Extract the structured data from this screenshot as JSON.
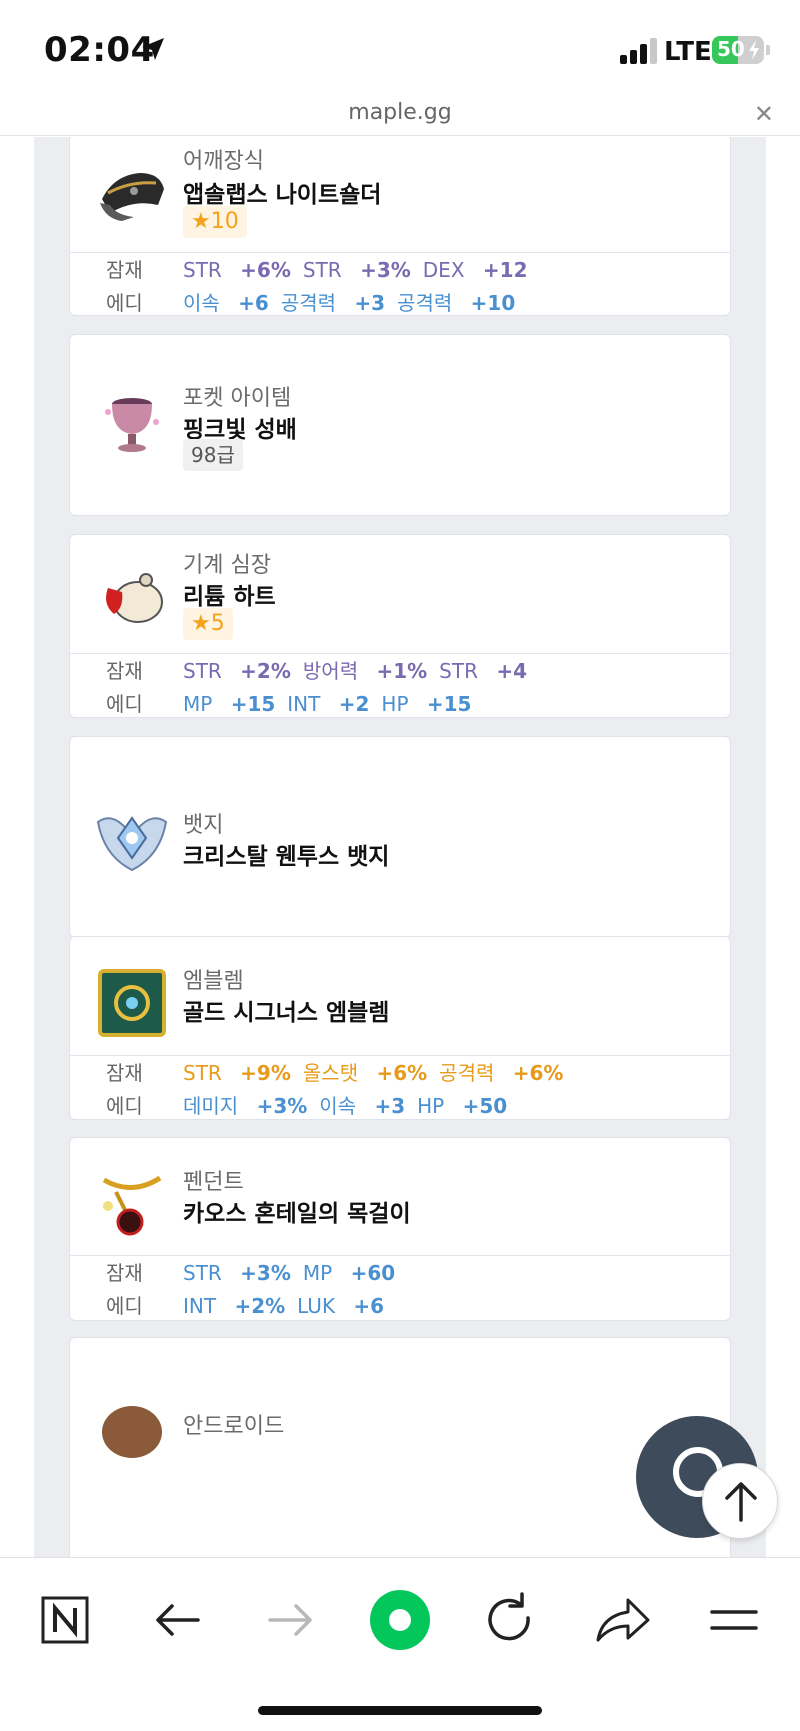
{
  "status_bar": {
    "time": "02:04",
    "network": "LTE",
    "battery": "50",
    "battery_level": 0.5
  },
  "browser": {
    "url": "maple.gg"
  },
  "labels": {
    "potential": "잠재",
    "additional": "에디"
  },
  "items": [
    {
      "category": "어깨장식",
      "name": "앱솔랩스 나이트숄더",
      "badge": "★10",
      "potential": [
        {
          "stat": "STR",
          "value": "+6%"
        },
        {
          "stat": "STR",
          "value": "+3%"
        },
        {
          "stat": "DEX",
          "value": "+12"
        }
      ],
      "additional": [
        {
          "stat": "이속",
          "value": "+6"
        },
        {
          "stat": "공격력",
          "value": "+3"
        },
        {
          "stat": "공격력",
          "value": "+10"
        }
      ]
    },
    {
      "category": "포켓 아이템",
      "name": "핑크빛 성배",
      "badge": "98급"
    },
    {
      "category": "기계 심장",
      "name": "리튬 하트",
      "badge": "★5",
      "potential": [
        {
          "stat": "STR",
          "value": "+2%"
        },
        {
          "stat": "방어력",
          "value": "+1%"
        },
        {
          "stat": "STR",
          "value": "+4"
        }
      ],
      "additional": [
        {
          "stat": "MP",
          "value": "+15"
        },
        {
          "stat": "INT",
          "value": "+2"
        },
        {
          "stat": "HP",
          "value": "+15"
        }
      ]
    },
    {
      "category": "뱃지",
      "name": "크리스탈 웬투스 뱃지"
    },
    {
      "category": "엠블렘",
      "name": "골드 시그너스 엠블렘",
      "potential": [
        {
          "stat": "STR",
          "value": "+9%"
        },
        {
          "stat": "올스탯",
          "value": "+6%"
        },
        {
          "stat": "공격력",
          "value": "+6%"
        }
      ],
      "additional": [
        {
          "stat": "데미지",
          "value": "+3%"
        },
        {
          "stat": "이속",
          "value": "+3"
        },
        {
          "stat": "HP",
          "value": "+50"
        }
      ]
    },
    {
      "category": "펜던트",
      "name": "카오스 혼테일의 목걸이",
      "potential": [
        {
          "stat": "STR",
          "value": "+3%"
        },
        {
          "stat": "MP",
          "value": "+60"
        }
      ],
      "additional": [
        {
          "stat": "INT",
          "value": "+2%"
        },
        {
          "stat": "LUK",
          "value": "+6"
        }
      ]
    },
    {
      "category": "안드로이드"
    }
  ],
  "colors": {
    "unique_purple": "#7a6ab0",
    "rare_blue": "#4a90d0",
    "legendary_gold": "#e89a1a",
    "star": "#f5a11a",
    "fab_dark": "#3e4b5b",
    "naver_green": "#03c75a"
  },
  "icons": {
    "toolbar": [
      "naver-home-icon",
      "back-arrow-icon",
      "forward-arrow-icon",
      "green-dot-icon",
      "reload-icon",
      "share-icon",
      "menu-icon"
    ],
    "floating": [
      "chat-icon",
      "scroll-top-icon"
    ]
  }
}
